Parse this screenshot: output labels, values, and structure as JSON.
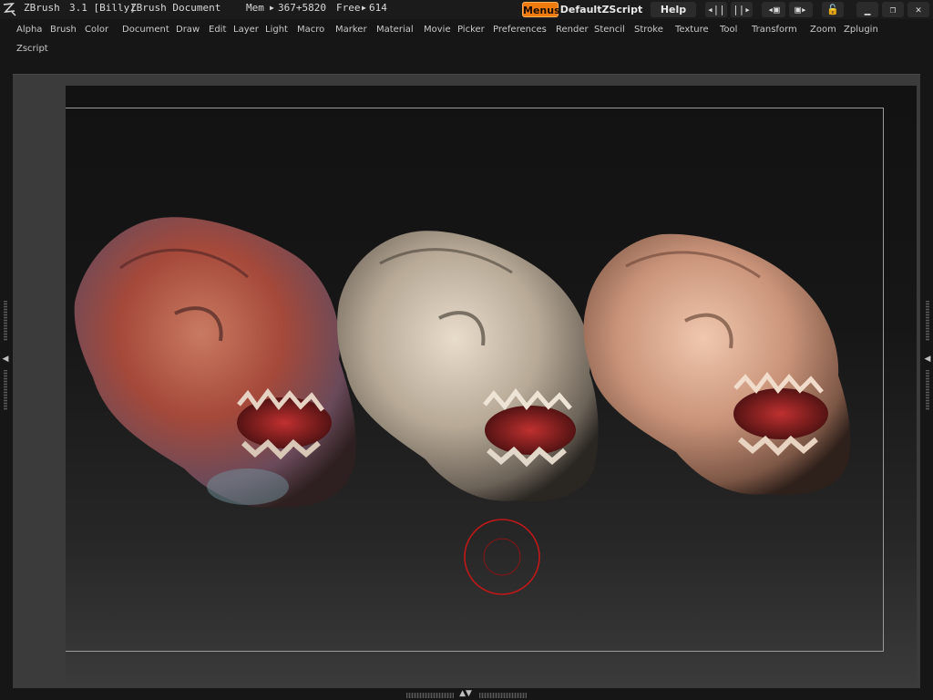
{
  "titlebar": {
    "app_name": "ZBrush",
    "version": "3.1 [Billy]",
    "document": "ZBrush Document",
    "mem_label": "Mem",
    "mem_value": "367+5820",
    "free_label": "Free",
    "free_value": "614",
    "menus_label": "Menus",
    "script_label": "DefaultZScript",
    "help_label": "Help"
  },
  "menubar": {
    "items": [
      "Alpha",
      "Brush",
      "Color",
      "Document",
      "Draw",
      "Edit",
      "Layer",
      "Light",
      "Macro",
      "Marker",
      "Material",
      "Movie",
      "Picker",
      "Preferences",
      "Render",
      "Stencil",
      "Stroke",
      "Texture",
      "Tool",
      "Transform",
      "Zoom",
      "Zplugin",
      "Zscript"
    ]
  },
  "colors": {
    "accent": "#f07c10",
    "cursor_ring": "#c01818",
    "background": "#161616"
  },
  "canvas": {
    "models": [
      "creature-head-textured",
      "creature-head-skin",
      "creature-head-flesh"
    ]
  }
}
